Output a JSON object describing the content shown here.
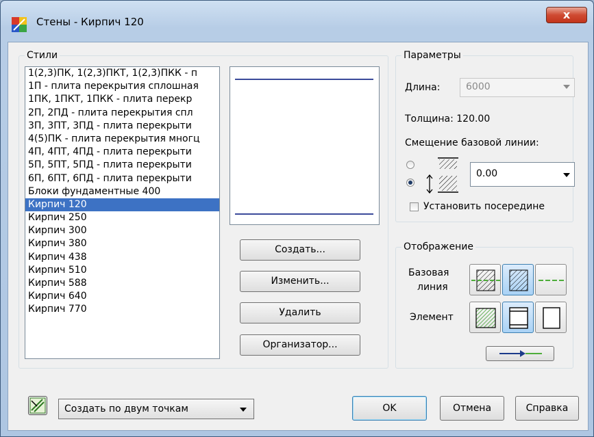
{
  "window": {
    "title": "Стены - Кирпич 120",
    "close_glyph": "x"
  },
  "styles": {
    "label": "Стили",
    "items": [
      "1(2,3)ПК, 1(2,3)ПКТ, 1(2,3)ПКК - п",
      "1П - плита перекрытия сплошная",
      "1ПК, 1ПКТ, 1ПКК - плита перекр",
      "2П, 2ПД - плита перекрытия спл",
      "3П, 3ПТ, 3ПД - плита перекрыти",
      "4(5)ПК  - плита перекрытия многц",
      "4П, 4ПТ, 4ПД - плита перекрыти",
      "5П, 5ПТ, 5ПД - плита перекрыти",
      "6П, 6ПТ, 6ПД - плита перекрыти",
      "Блоки фундаментные 400",
      "Кирпич 120",
      "Кирпич 250",
      "Кирпич 300",
      "Кирпич 380",
      "Кирпич 438",
      "Кирпич 510",
      "Кирпич 588",
      "Кирпич 640",
      "Кирпич 770"
    ],
    "selected": "Кирпич 120"
  },
  "buttons": {
    "create": "Создать...",
    "edit": "Изменить...",
    "delete": "Удалить",
    "organizer": "Организатор..."
  },
  "params": {
    "label": "Параметры",
    "length_label": "Длина:",
    "length_value": "6000",
    "thickness": "Толщина: 120.00",
    "offset_label": "Смещение базовой линии:",
    "offset_value": "0.00",
    "center_label": "Установить посередине"
  },
  "display": {
    "label": "Отображение",
    "baseline_label_1": "Базовая",
    "baseline_label_2": "линия",
    "element_label": "Элемент"
  },
  "footer": {
    "mode_value": "Создать по двум точкам",
    "ok": "OK",
    "cancel": "Отмена",
    "help": "Справка"
  },
  "colors": {
    "selection": "#3d72c4",
    "preview_line": "#3a4a9a",
    "default_button_border": "#3c7fb1"
  }
}
